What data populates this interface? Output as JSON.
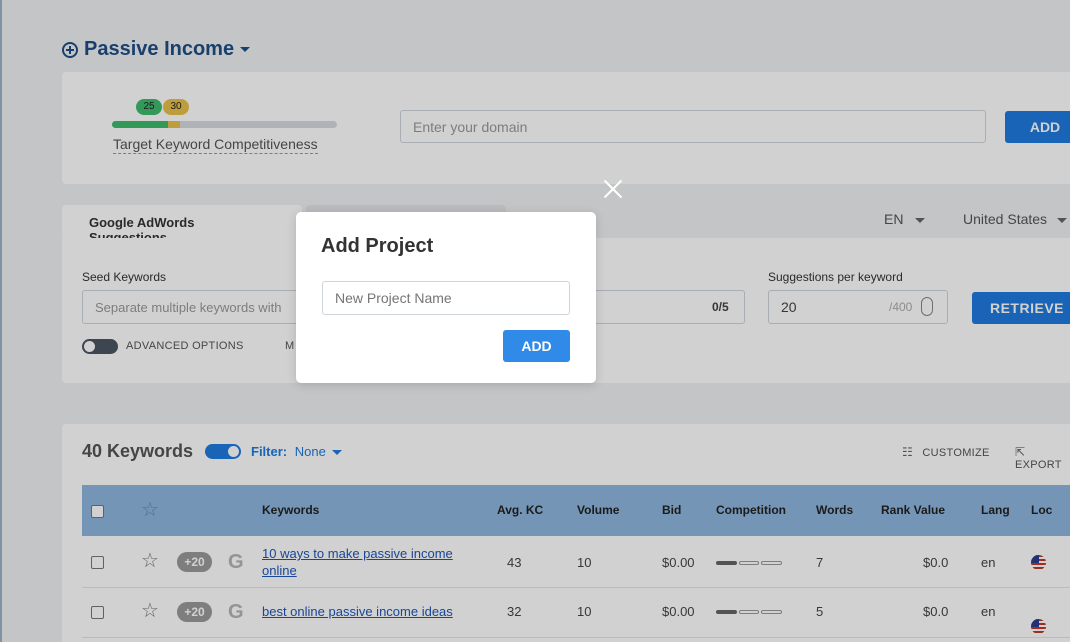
{
  "project": {
    "title": "Passive Income"
  },
  "kc": {
    "low": "25",
    "high": "30",
    "label": "Target Keyword Competitiveness"
  },
  "domain": {
    "placeholder": "Enter your domain",
    "add_label": "ADD"
  },
  "tabs": {
    "active": "Google AdWords Suggestions"
  },
  "locale": {
    "language": "EN",
    "country": "United States"
  },
  "seed": {
    "label": "Seed Keywords",
    "placeholder": "Separate multiple keywords with",
    "count": "0/5"
  },
  "suggestions": {
    "label": "Suggestions per keyword",
    "value": "20",
    "max": "/400"
  },
  "retrieve_label": "RETRIEVE",
  "advanced": {
    "label": "ADVANCED OPTIONS",
    "more": "M"
  },
  "results": {
    "count_label": "40 Keywords",
    "filter_label": "Filter:",
    "filter_value": "None",
    "customize_label": "CUSTOMIZE",
    "export_label": "EXPORT"
  },
  "table": {
    "headers": {
      "keywords": "Keywords",
      "avg_kc": "Avg. KC",
      "volume": "Volume",
      "bid": "Bid",
      "competition": "Competition",
      "words": "Words",
      "rank_value": "Rank Value",
      "lang": "Lang",
      "loc": "Loc"
    },
    "rows": [
      {
        "badge": "+20",
        "keyword_line1": "10 ways to make passive income",
        "keyword_line2": "online",
        "avg_kc": "43",
        "volume": "10",
        "bid": "$0.00",
        "competition": 0.33,
        "words": "7",
        "rank_value": "$0.0",
        "lang": "en"
      },
      {
        "badge": "+20",
        "keyword_line1": "best online passive income ideas",
        "keyword_line2": "",
        "avg_kc": "32",
        "volume": "10",
        "bid": "$0.00",
        "competition": 0.33,
        "words": "5",
        "rank_value": "$0.0",
        "lang": "en"
      }
    ]
  },
  "modal": {
    "title": "Add Project",
    "placeholder": "New Project Name",
    "add_label": "ADD"
  },
  "icons": {
    "close": "close-icon",
    "star": "star-icon",
    "google": "google-icon",
    "flag": "us-flag-icon",
    "customize": "sliders-icon",
    "export": "export-icon"
  },
  "colors": {
    "accent": "#1f7ae0",
    "title": "#1f4e86",
    "kc_green": "#3dbb6d",
    "kc_yellow": "#e7c04a"
  }
}
